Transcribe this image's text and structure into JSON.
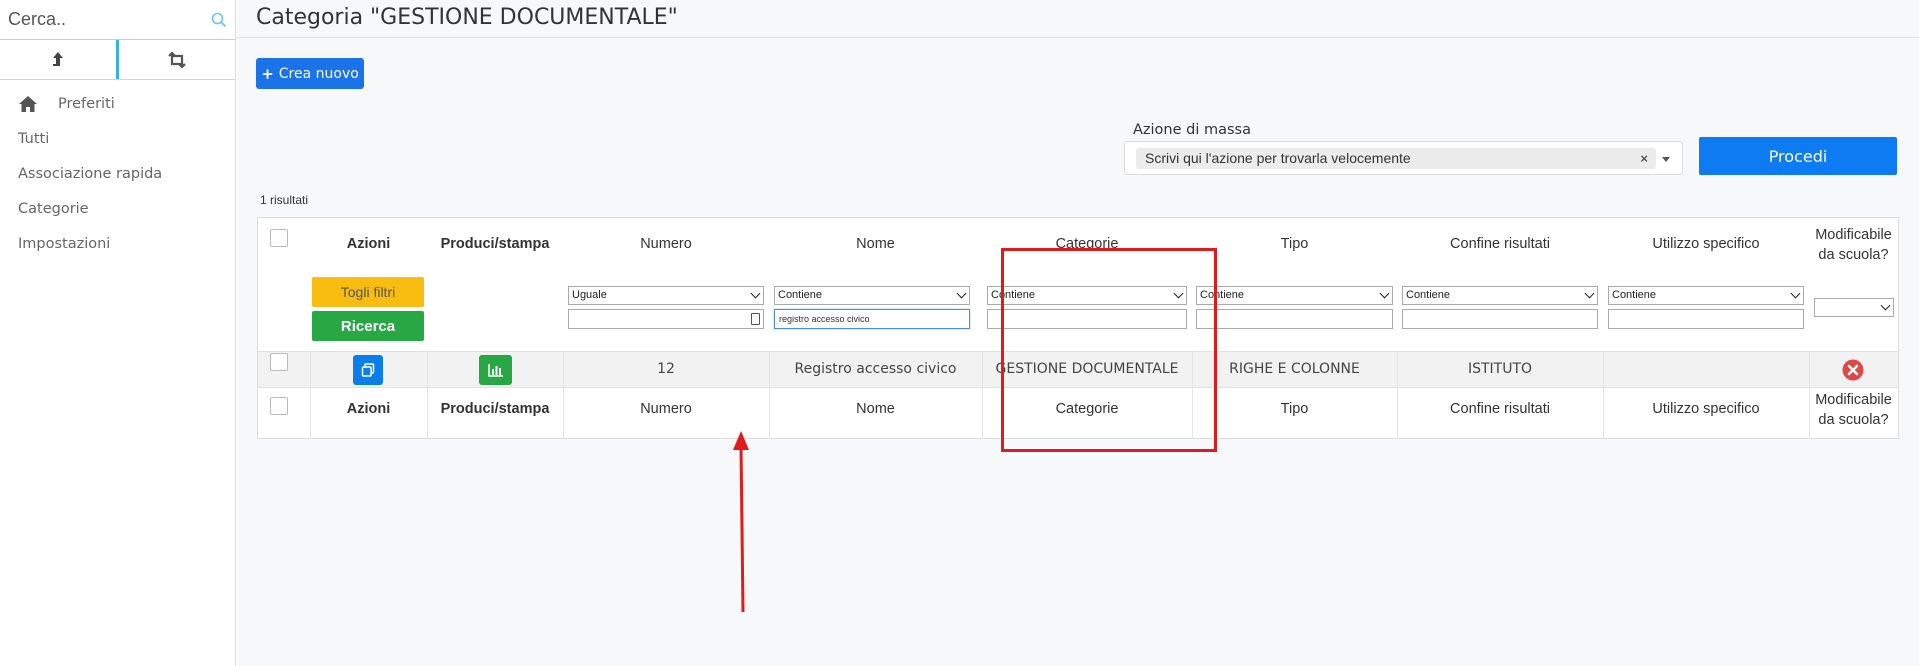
{
  "sidebar": {
    "search": {
      "placeholder": "Cerca..",
      "value": ""
    },
    "nav": [
      "Preferiti",
      "Tutti",
      "Associazione rapida",
      "Categorie",
      "Impostazioni"
    ]
  },
  "header": {
    "title": "Categoria \"GESTIONE DOCUMENTALE\""
  },
  "toolbar": {
    "create_label": "Crea nuovo"
  },
  "mass_action": {
    "label": "Azione di massa",
    "placeholder": "Scrivi qui l'azione per trovarla velocemente",
    "clear": "×",
    "proceed_label": "Procedi"
  },
  "results": {
    "count_label": "1 risultati"
  },
  "table": {
    "headers": {
      "azioni": "Azioni",
      "produci": "Produci/stampa",
      "numero": "Numero",
      "nome": "Nome",
      "categorie": "Categorie",
      "tipo": "Tipo",
      "confine": "Confine risultati",
      "utilizzo": "Utilizzo specifico",
      "modificabile": "Modificabile da scuola?"
    },
    "buttons": {
      "togli_filtri": "Togli filtri",
      "ricerca": "Ricerca"
    },
    "filters": {
      "numero_op": "Uguale",
      "nome_op": "Contiene",
      "nome_value": "registro accesso civico",
      "categorie_op": "Contiene",
      "tipo_op": "Contiene",
      "confine_op": "Contiene",
      "utilizzo_op": "Contiene",
      "modificabile_op": ""
    },
    "rows": [
      {
        "numero": "12",
        "nome": "Registro accesso civico",
        "categorie": "GESTIONE DOCUMENTALE",
        "tipo": "RIGHE E COLONNE",
        "confine": "ISTITUTO",
        "utilizzo": ""
      }
    ]
  },
  "colors": {
    "primary": "#1a73e8",
    "warning": "#f9bd12",
    "success": "#27a844",
    "danger": "#e04848",
    "annotation": "#e01b1b",
    "sidebar_accent": "#3ab0e2"
  },
  "icons": {
    "search": "search-icon",
    "upload": "arrow-up-icon",
    "swap": "retweet-icon",
    "home": "home-icon",
    "copy": "copy-icon",
    "chart": "bar-chart-icon",
    "delete": "delete-circle-icon"
  }
}
